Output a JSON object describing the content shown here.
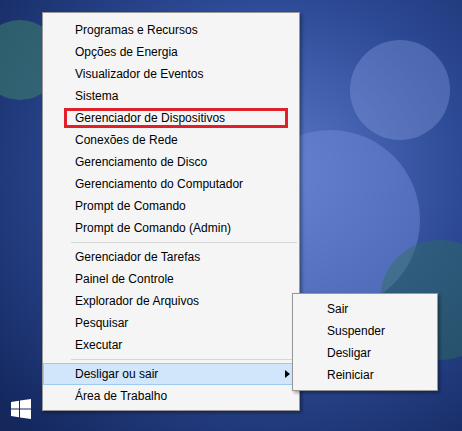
{
  "window": {
    "title": "Win+X menu on Windows desktop"
  },
  "menu": {
    "groups": [
      [
        {
          "label": "Programas e Recursos",
          "selected": false,
          "highlighted": false,
          "submenu": false
        },
        {
          "label": "Opções de Energia",
          "selected": false,
          "highlighted": false,
          "submenu": false
        },
        {
          "label": "Visualizador de Eventos",
          "selected": false,
          "highlighted": false,
          "submenu": false
        },
        {
          "label": "Sistema",
          "selected": false,
          "highlighted": false,
          "submenu": false
        },
        {
          "label": "Gerenciador de Dispositivos",
          "selected": false,
          "highlighted": true,
          "submenu": false
        },
        {
          "label": "Conexões de Rede",
          "selected": false,
          "highlighted": false,
          "submenu": false
        },
        {
          "label": "Gerenciamento de Disco",
          "selected": false,
          "highlighted": false,
          "submenu": false
        },
        {
          "label": "Gerenciamento do Computador",
          "selected": false,
          "highlighted": false,
          "submenu": false
        },
        {
          "label": "Prompt de Comando",
          "selected": false,
          "highlighted": false,
          "submenu": false
        },
        {
          "label": "Prompt de Comando (Admin)",
          "selected": false,
          "highlighted": false,
          "submenu": false
        }
      ],
      [
        {
          "label": "Gerenciador de Tarefas",
          "selected": false,
          "highlighted": false,
          "submenu": false
        },
        {
          "label": "Painel de Controle",
          "selected": false,
          "highlighted": false,
          "submenu": false
        },
        {
          "label": "Explorador de Arquivos",
          "selected": false,
          "highlighted": false,
          "submenu": false
        },
        {
          "label": "Pesquisar",
          "selected": false,
          "highlighted": false,
          "submenu": false
        },
        {
          "label": "Executar",
          "selected": false,
          "highlighted": false,
          "submenu": false
        }
      ],
      [
        {
          "label": "Desligar ou sair",
          "selected": true,
          "highlighted": false,
          "submenu": true
        },
        {
          "label": "Área de Trabalho",
          "selected": false,
          "highlighted": false,
          "submenu": false
        }
      ]
    ]
  },
  "submenu": {
    "items": [
      {
        "label": "Sair"
      },
      {
        "label": "Suspender"
      },
      {
        "label": "Desligar"
      },
      {
        "label": "Reiniciar"
      }
    ]
  }
}
